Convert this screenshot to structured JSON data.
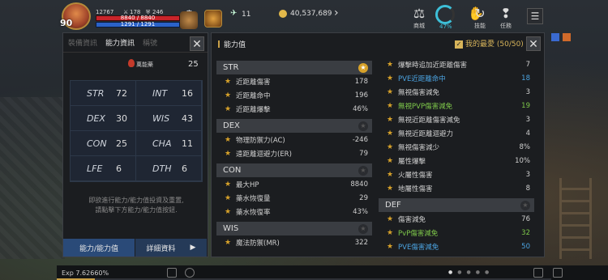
{
  "hud": {
    "level": "90",
    "mini_stat_1": "12767",
    "mini_stat_2": "178",
    "mini_stat_3": "246",
    "hp_text": "8840 / 8840",
    "mp_text": "1291 / 1291",
    "gem_count": "11",
    "gold": "40,537,689",
    "shop_label": "商城",
    "percent": "47%",
    "skill_label": "技能",
    "quest_label": "任務"
  },
  "left_panel": {
    "tabs": [
      "裝備資訊",
      "能力資訊",
      "稱號"
    ],
    "active_tab_index": 1,
    "remaining_label": "萬能藥",
    "remaining_value": "25",
    "stats": [
      {
        "key": "STR",
        "value": "72"
      },
      {
        "key": "INT",
        "value": "16"
      },
      {
        "key": "DEX",
        "value": "30"
      },
      {
        "key": "WIS",
        "value": "43"
      },
      {
        "key": "CON",
        "value": "25"
      },
      {
        "key": "CHA",
        "value": "11"
      },
      {
        "key": "LFE",
        "value": "6"
      },
      {
        "key": "DTH",
        "value": "6"
      }
    ],
    "note_line1": "即欲進行能力/能力值投資及重置,",
    "note_line2": "請點擊下方能力/能力值按鈕.",
    "btn_ability": "能力/能力值",
    "btn_detail": "詳細資料"
  },
  "right_panel": {
    "title": "能力值",
    "favorite": "我的最愛 (50/50)",
    "left_sections": [
      {
        "name": "STR",
        "starred": true,
        "rows": [
          {
            "name": "近距離傷害",
            "value": "178",
            "color": ""
          },
          {
            "name": "近距離命中",
            "value": "196",
            "color": ""
          },
          {
            "name": "近距離爆擊",
            "value": "46%",
            "color": ""
          }
        ]
      },
      {
        "name": "DEX",
        "starred": false,
        "rows": [
          {
            "name": "物理防禦力(AC)",
            "value": "-246",
            "color": ""
          },
          {
            "name": "遠距離迴避力(ER)",
            "value": "79",
            "color": ""
          }
        ]
      },
      {
        "name": "CON",
        "starred": false,
        "rows": [
          {
            "name": "最大HP",
            "value": "8840",
            "color": ""
          },
          {
            "name": "藥水恢復量",
            "value": "29",
            "color": ""
          },
          {
            "name": "藥水恢復率",
            "value": "43%",
            "color": ""
          }
        ]
      },
      {
        "name": "WIS",
        "starred": false,
        "rows": [
          {
            "name": "魔法防禦(MR)",
            "value": "322",
            "color": ""
          }
        ]
      }
    ],
    "right_rows_top": [
      {
        "name": "爆擊時追加近距離傷害",
        "value": "7",
        "color": ""
      },
      {
        "name": "PVE近距離命中",
        "value": "18",
        "color": "blue"
      },
      {
        "name": "無視傷害減免",
        "value": "3",
        "color": ""
      },
      {
        "name": "無視PVP傷害減免",
        "value": "19",
        "color": "green"
      },
      {
        "name": "無視近距離傷害減免",
        "value": "3",
        "color": ""
      },
      {
        "name": "無視近距離迴避力",
        "value": "4",
        "color": ""
      },
      {
        "name": "無視傷害減少",
        "value": "8%",
        "color": ""
      },
      {
        "name": "屬性爆擊",
        "value": "10%",
        "color": ""
      },
      {
        "name": "火屬性傷害",
        "value": "3",
        "color": ""
      },
      {
        "name": "地屬性傷害",
        "value": "8",
        "color": ""
      }
    ],
    "right_sections": [
      {
        "name": "DEF",
        "starred": false,
        "rows": [
          {
            "name": "傷害減免",
            "value": "76",
            "color": ""
          },
          {
            "name": "PvP傷害減免",
            "value": "32",
            "color": "green"
          },
          {
            "name": "PVE傷害減免",
            "value": "50",
            "color": "blue"
          }
        ]
      }
    ]
  },
  "bottom": {
    "exp": "Exp 7.62660%",
    "exp_fraction": 0.076266
  },
  "colors": {
    "accent_gold": "#d7a22a",
    "hp_red": "#c8242a",
    "mp_blue": "#2b62c8",
    "stat_blue": "#4ba3e0",
    "stat_green": "#7ec84a"
  }
}
